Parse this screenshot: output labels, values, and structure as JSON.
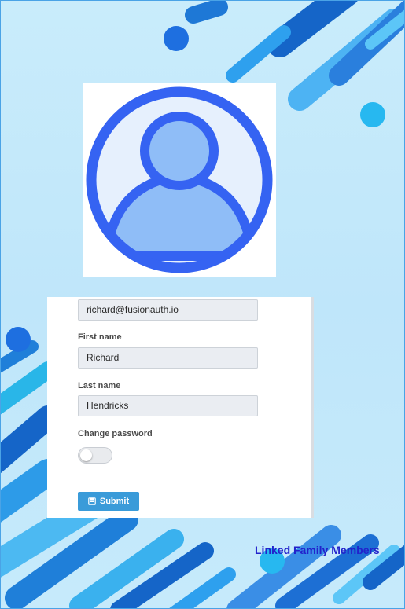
{
  "form": {
    "email_value": "richard@fusionauth.io",
    "first_name_label": "First name",
    "first_name_value": "Richard",
    "last_name_label": "Last name",
    "last_name_value": "Hendricks",
    "change_password_label": "Change password",
    "change_password_enabled": false,
    "submit_label": "Submit"
  },
  "footer": {
    "linked_family_label": "Linked Family Members"
  },
  "colors": {
    "accent": "#3a9bd9",
    "avatar_stroke": "#3563f2",
    "avatar_fill": "#8fbdf7",
    "link": "#2222cc"
  },
  "icons": {
    "avatar": "user-avatar-icon",
    "submit": "save-icon"
  }
}
